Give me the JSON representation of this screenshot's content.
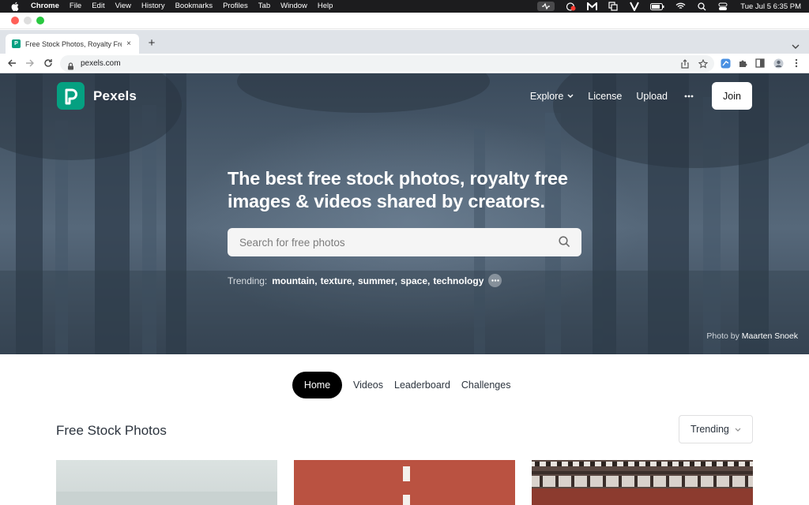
{
  "menubar": {
    "app_name": "Chrome",
    "items": [
      "File",
      "Edit",
      "View",
      "History",
      "Bookmarks",
      "Profiles",
      "Tab",
      "Window",
      "Help"
    ],
    "clock": "Tue Jul 5  6:35 PM"
  },
  "browser": {
    "tab_title": "Free Stock Photos, Royalty Free",
    "tab_close": "×",
    "new_tab": "+",
    "url": "pexels.com"
  },
  "site": {
    "brand": "Pexels",
    "nav": {
      "explore": "Explore",
      "license": "License",
      "upload": "Upload",
      "join": "Join"
    },
    "hero": {
      "headline_line1": "The best free stock photos, royalty free",
      "headline_line2": "images & videos shared by creators.",
      "search_placeholder": "Search for free photos",
      "trending_label": "Trending:",
      "trending_tags": [
        "mountain",
        "texture",
        "summer",
        "space",
        "technology"
      ],
      "credit_prefix": "Photo by",
      "credit_name": "Maarten Snoek"
    },
    "tabs": {
      "home": "Home",
      "videos": "Videos",
      "leaderboard": "Leaderboard",
      "challenges": "Challenges"
    },
    "section_title": "Free Stock Photos",
    "sort_label": "Trending"
  },
  "colors": {
    "brand": "#05a081",
    "hero_overlay": "#3b4b5c",
    "text_dark": "#2c343e"
  }
}
